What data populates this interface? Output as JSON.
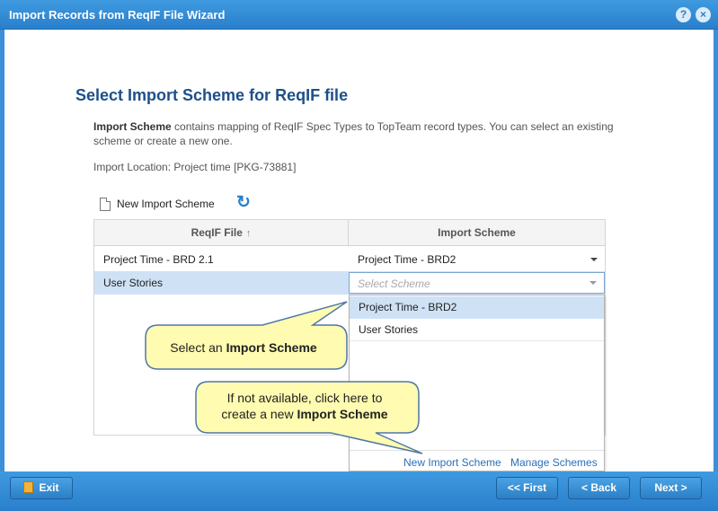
{
  "window": {
    "title": "Import Records from ReqIF File Wizard",
    "help_glyph": "?",
    "close_glyph": "×"
  },
  "page": {
    "heading": "Select Import Scheme for ReqIF file",
    "desc_bold": "Import Scheme",
    "desc_rest": " contains mapping of ReqIF Spec Types to TopTeam record types. You can select an existing scheme or create a new one.",
    "location_label": "Import Location:",
    "location_value": " Project time [PKG-73881]"
  },
  "toolbar": {
    "new_scheme_label": "New Import Scheme",
    "refresh_glyph": "↻"
  },
  "grid": {
    "columns": [
      "ReqIF File",
      "Import Scheme"
    ],
    "sort_glyph": "↑",
    "rows": [
      {
        "file": "Project Time - BRD 2.1",
        "scheme": "Project Time - BRD2"
      },
      {
        "file": "User Stories",
        "scheme_placeholder": "Select Scheme"
      }
    ]
  },
  "dropdown": {
    "options": [
      "Project Time - BRD2",
      "User Stories"
    ],
    "selected_index": 0,
    "links": [
      "New Import Scheme",
      "Manage Schemes"
    ]
  },
  "callouts": {
    "one_prefix": "Select an ",
    "one_bold": "Import Scheme",
    "two_line1": "If not available, click here to",
    "two_prefix": "create a new ",
    "two_bold": "Import Scheme"
  },
  "footer": {
    "exit_label": "Exit",
    "first_label": "<< First",
    "back_label": "< Back",
    "next_label": "Next >"
  }
}
